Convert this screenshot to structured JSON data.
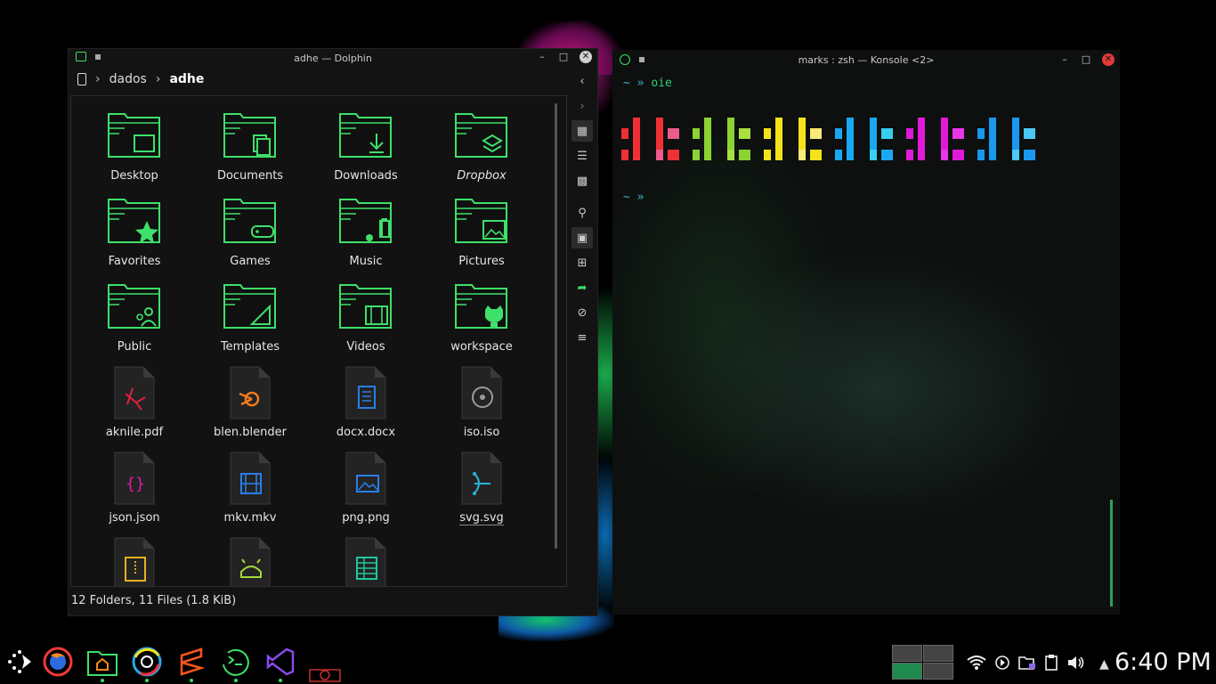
{
  "dolphin": {
    "title": "adhe — Dolphin",
    "breadcrumb": [
      "dados",
      "adhe"
    ],
    "items": [
      {
        "name": "Desktop",
        "kind": "folder",
        "emblem": "desktop-icon"
      },
      {
        "name": "Documents",
        "kind": "folder",
        "emblem": "documents-icon"
      },
      {
        "name": "Downloads",
        "kind": "folder",
        "emblem": "download-icon"
      },
      {
        "name": "Dropbox",
        "kind": "folder",
        "emblem": "dropbox-icon"
      },
      {
        "name": "Favorites",
        "kind": "folder",
        "emblem": "star-icon"
      },
      {
        "name": "Games",
        "kind": "folder",
        "emblem": "gamepad-icon"
      },
      {
        "name": "Music",
        "kind": "folder",
        "emblem": "music-icon"
      },
      {
        "name": "Pictures",
        "kind": "folder",
        "emblem": "picture-icon"
      },
      {
        "name": "Public",
        "kind": "folder",
        "emblem": "users-icon"
      },
      {
        "name": "Templates",
        "kind": "folder",
        "emblem": "template-icon"
      },
      {
        "name": "Videos",
        "kind": "folder",
        "emblem": "film-icon"
      },
      {
        "name": "workspace",
        "kind": "folder",
        "emblem": "github-icon"
      },
      {
        "name": "aknile.pdf",
        "kind": "file",
        "emblem": "pdf-icon",
        "color": "#e0213a"
      },
      {
        "name": "blen.blender",
        "kind": "file",
        "emblem": "blender-icon",
        "color": "#f07b1c"
      },
      {
        "name": "docx.docx",
        "kind": "file",
        "emblem": "document-icon",
        "color": "#2a7ee8"
      },
      {
        "name": "iso.iso",
        "kind": "file",
        "emblem": "disc-icon",
        "color": "#9a9a9a"
      },
      {
        "name": "json.json",
        "kind": "file",
        "emblem": "json-icon",
        "color": "#e01aa8"
      },
      {
        "name": "mkv.mkv",
        "kind": "file",
        "emblem": "video-icon",
        "color": "#2a7ee8"
      },
      {
        "name": "png.png",
        "kind": "file",
        "emblem": "image-icon",
        "color": "#2a7ee8"
      },
      {
        "name": "svg.svg",
        "kind": "file",
        "emblem": "vector-icon",
        "color": "#26b4d8"
      },
      {
        "name": "",
        "kind": "file",
        "emblem": "archive-icon",
        "color": "#e8b01c"
      },
      {
        "name": "",
        "kind": "file",
        "emblem": "android-icon",
        "color": "#a6d83a"
      },
      {
        "name": "",
        "kind": "file",
        "emblem": "spreadsheet-icon",
        "color": "#1ec8a0"
      }
    ],
    "status": "12 Folders, 11 Files (1.8 KiB)",
    "tools": [
      "panel-view-icon",
      "details-view-icon",
      "compact-view-icon",
      "search-icon",
      "preview-icon",
      "new-tab-icon",
      "terminal-icon",
      "hidden-files-icon",
      "menu-icon"
    ]
  },
  "konsole": {
    "title": "marks : zsh — Konsole <2>",
    "line1_prompt": "~ »",
    "line1_cmd": "oie",
    "line2_prompt": "~ »",
    "colors": [
      "#ef2f35",
      "#ee5a8a",
      "#8bd233",
      "#a8e03e",
      "#f4e21b",
      "#fbe97a",
      "#1aa8f0",
      "#35d0f0",
      "#e01ad8",
      "#e836e8",
      "#1a98f0",
      "#4cc8f8"
    ]
  },
  "taskbar": {
    "apps": [
      "launcher-icon",
      "firefox-icon",
      "file-manager-icon",
      "chromium-icon",
      "sublime-icon",
      "terminal-icon",
      "vscode-icon",
      "app-icon"
    ],
    "clock": "6:40 PM",
    "tray": [
      "wifi-icon",
      "media-icon",
      "folder-lock-icon",
      "clipboard-icon",
      "volume-icon",
      "expand-icon"
    ]
  }
}
